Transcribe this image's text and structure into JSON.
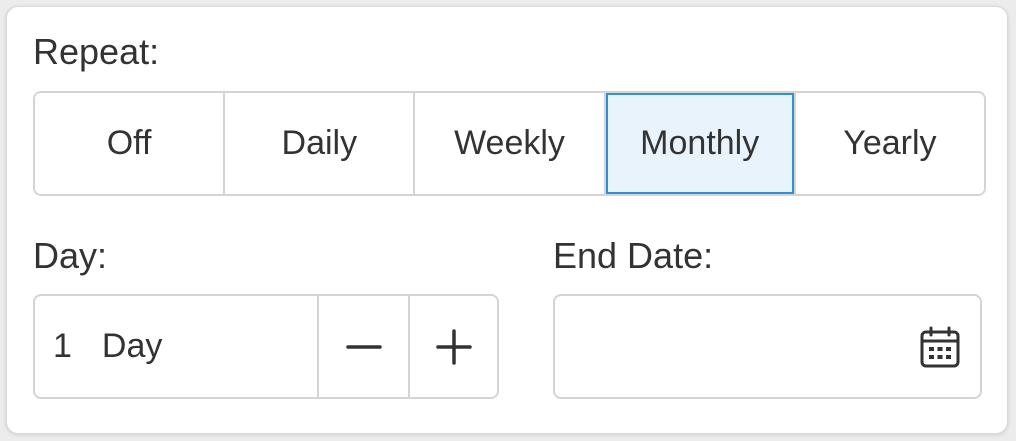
{
  "repeat": {
    "label": "Repeat:",
    "options": [
      "Off",
      "Daily",
      "Weekly",
      "Monthly",
      "Yearly"
    ],
    "selected": "Monthly"
  },
  "day": {
    "label": "Day:",
    "value": "1",
    "unit": "Day",
    "decrement_icon": "minus-icon",
    "increment_icon": "plus-icon"
  },
  "end_date": {
    "label": "End Date:",
    "value": "",
    "icon": "calendar-icon"
  },
  "colors": {
    "accent": "#2f8fdc",
    "selected_bg": "#e8f3fb",
    "border": "#d4d4d4",
    "text": "#333333"
  }
}
